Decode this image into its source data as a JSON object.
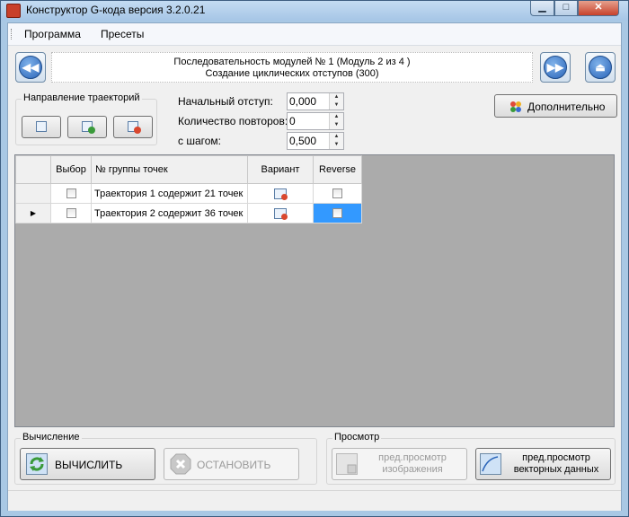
{
  "window": {
    "title": "Конструктор G-кода версия 3.2.0.21",
    "min_glyph": "▁",
    "max_glyph": "□",
    "close_glyph": "✕"
  },
  "menu": {
    "items": [
      "Программа",
      "Пресеты"
    ]
  },
  "nav": {
    "prev_glyph": "◀◀",
    "next_glyph": "▶▶",
    "eject_glyph": "⏏",
    "info_line1": "Последовательность модулей № 1 (Модуль 2 из 4 )",
    "info_line2": "Создание циклических отступов (300)"
  },
  "direction_group": {
    "title": "Направление траекторий"
  },
  "params": {
    "initial_offset_label": "Начальный отступ:",
    "initial_offset_value": "0,000",
    "repeat_count_label": "Количество повторов:",
    "repeat_count_value": "0",
    "step_label": "с шагом:",
    "step_value": "0,500"
  },
  "extra_button": {
    "label": "Дополнительно"
  },
  "grid": {
    "columns": [
      "Выбор",
      "№ группы точек",
      "Вариант",
      "Reverse"
    ],
    "rows": [
      {
        "name": "Траектория 1 содержит 21 точек",
        "selected": false,
        "reverse": false
      },
      {
        "name": "Траектория 2 содержит 36 точек",
        "selected": false,
        "reverse": false
      }
    ],
    "current_row_marker": "▶"
  },
  "compute_group": {
    "title": "Вычисление",
    "compute_label": "ВЫЧИСЛИТЬ",
    "stop_label": "ОСТАНОВИТЬ"
  },
  "preview_group": {
    "title": "Просмотр",
    "image_preview_line1": "пред.просмотр",
    "image_preview_line2": "изображения",
    "vector_preview_line1": "пред.просмотр",
    "vector_preview_line2": "векторных данных"
  },
  "colors": {
    "selection": "#3399ff",
    "accent_blue": "#2a64b8",
    "badge_red": "#d9472e",
    "badge_green": "#3a9a3a"
  }
}
